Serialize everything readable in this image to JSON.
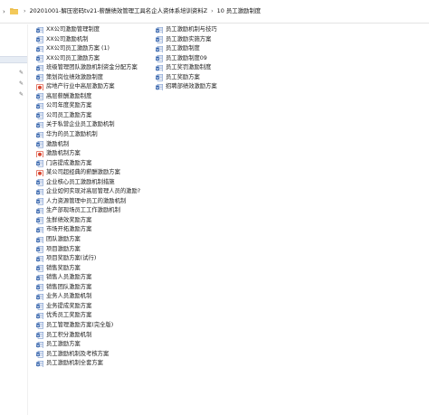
{
  "address": {
    "path": [
      "20201001-解压密码tv21-薪酬绩效管理工具名企人资体系培训资料Z",
      "10 员工激励制度"
    ]
  },
  "files": {
    "left": [
      {
        "name": "XX公司激励管理制度",
        "icon": "word-doc-icon"
      },
      {
        "name": "XX公司激励机制",
        "icon": "word-doc-icon"
      },
      {
        "name": "XX公司员工激励方案 (1)",
        "icon": "word-doc-icon"
      },
      {
        "name": "XX公司员工激励方案",
        "icon": "word-doc-icon"
      },
      {
        "name": "班级管理团队激励机制资金分配方案",
        "icon": "word-doc-icon"
      },
      {
        "name": "策划岗位绩效激励制度",
        "icon": "word-doc-icon"
      },
      {
        "name": "房地产行业中高层激励方案",
        "icon": "pdf-doc-icon"
      },
      {
        "name": "高层薪酬激励制度",
        "icon": "word-doc-icon"
      },
      {
        "name": "公司年度奖励方案",
        "icon": "word-doc-icon"
      },
      {
        "name": "公司员工激励方案",
        "icon": "word-doc-icon"
      },
      {
        "name": "关于私营企业员工激励机制",
        "icon": "word-doc-icon"
      },
      {
        "name": "华为的员工激励机制",
        "icon": "word-doc-icon"
      },
      {
        "name": "激励机制",
        "icon": "word-doc-icon"
      },
      {
        "name": "激励机制方案",
        "icon": "pdf-doc-icon"
      },
      {
        "name": "门店提成激励方案",
        "icon": "word-doc-icon"
      },
      {
        "name": "某公司超经典的薪酬激励方案",
        "icon": "pdf-doc-icon"
      },
      {
        "name": "企业核心员工激励机制措施",
        "icon": "word-doc-icon"
      },
      {
        "name": "企业如何实现对高层管理人员的激励?",
        "icon": "word-doc-icon"
      },
      {
        "name": "人力资源管理中员工的激励机制",
        "icon": "word-doc-icon"
      },
      {
        "name": "生产部现场员工工作激励机制",
        "icon": "word-doc-icon"
      },
      {
        "name": "生鲜绩效奖励方案",
        "icon": "word-doc-icon"
      },
      {
        "name": "市场开拓激励方案",
        "icon": "word-doc-icon"
      },
      {
        "name": "团队激励方案",
        "icon": "word-doc-icon"
      },
      {
        "name": "项目激励方案",
        "icon": "word-doc-icon"
      },
      {
        "name": "项目奖励方案(试行)",
        "icon": "word-doc-icon"
      },
      {
        "name": "销售奖励方案",
        "icon": "word-doc-icon"
      },
      {
        "name": "销售人员激励方案",
        "icon": "word-doc-icon"
      },
      {
        "name": "销售团队激励方案",
        "icon": "word-doc-icon"
      },
      {
        "name": "业务人员激励机制",
        "icon": "word-doc-icon"
      },
      {
        "name": "业务提成奖励方案",
        "icon": "word-doc-icon"
      },
      {
        "name": "优秀员工奖励方案",
        "icon": "word-doc-icon"
      },
      {
        "name": "员工管理激励方案(完全版)",
        "icon": "word-doc-icon"
      },
      {
        "name": "员工积分激励机制",
        "icon": "word-doc-icon"
      },
      {
        "name": "员工激励方案",
        "icon": "word-doc-icon"
      },
      {
        "name": "员工激励机制及考核方案",
        "icon": "word-doc-icon"
      },
      {
        "name": "员工激励机制全套方案",
        "icon": "word-doc-icon"
      }
    ],
    "right": [
      {
        "name": "员工激励机制与技巧",
        "icon": "word-doc-icon"
      },
      {
        "name": "员工激励实施方案",
        "icon": "word-doc-icon"
      },
      {
        "name": "员工激励制度",
        "icon": "word-doc-icon"
      },
      {
        "name": "员工激励制度09",
        "icon": "word-doc-icon"
      },
      {
        "name": "员工奖罚激励制度",
        "icon": "word-doc-icon"
      },
      {
        "name": "员工奖励方案",
        "icon": "word-doc-icon"
      },
      {
        "name": "招聘部绩效激励方案",
        "icon": "word-doc-icon"
      }
    ]
  },
  "colors": {
    "word_icon": "#2b5ca8",
    "pdf_icon": "#d9452f",
    "folder_icon": "#e8b53c",
    "selection": "#e6ecf4"
  }
}
